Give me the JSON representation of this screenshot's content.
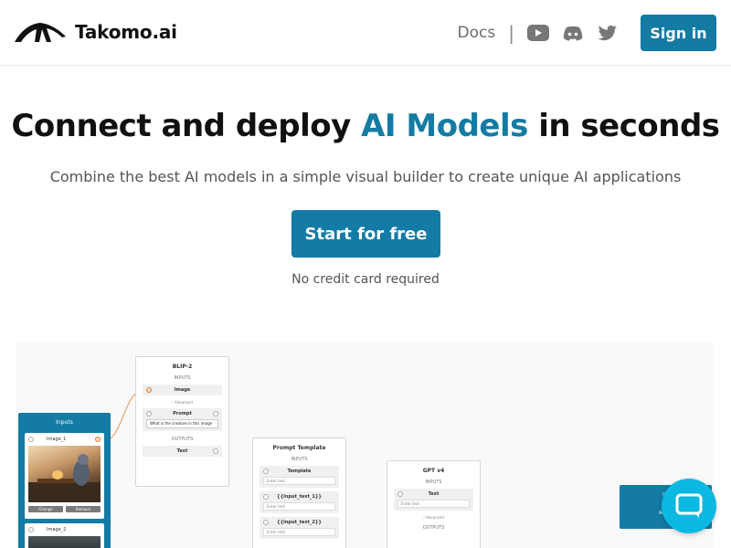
{
  "header": {
    "brand": "Takomo.ai",
    "nav_docs": "Docs",
    "nav_separator": "|",
    "icons": [
      "youtube-icon",
      "discord-icon",
      "twitter-icon"
    ],
    "signin_label": "Sign in"
  },
  "hero": {
    "title_prefix": "Connect and deploy ",
    "title_accent": "AI Models",
    "title_suffix": " in seconds",
    "subtitle": "Combine the best AI models in a simple visual builder to create unique AI applications",
    "cta_label": "Start for free",
    "cta_note": "No credit card required"
  },
  "builder": {
    "inputs_node": {
      "title": "Inputs",
      "image_1_label": "Image_1",
      "image_2_label": "Image_2",
      "change_label": "Change",
      "remove_label": "Remove"
    },
    "blip_node": {
      "title": "BLIP-2",
      "inputs_label": "INPUTS",
      "image_field": "Image",
      "advanced_label": "Advanced",
      "prompt_field": "Prompt",
      "prompt_value": "What is the creature in this image",
      "outputs_label": "OUTPUTS",
      "text_output": "Text"
    },
    "prompt_node": {
      "title": "Prompt Template",
      "inputs_label": "INPUTS",
      "template_field": "Template",
      "template_placeholder": "Enter text",
      "var1_field": "{{input_text_1}}",
      "var1_placeholder": "Enter text",
      "var2_field": "{{input_text_2}}",
      "var2_placeholder": "Enter text"
    },
    "gpt_node": {
      "title": "GPT v4",
      "inputs_label": "INPUTS",
      "text_field": "Text",
      "text_placeholder": "Enter text",
      "advanced_label": "Advanced",
      "outputs_label": "OUTPUTS"
    },
    "output_node": {
      "title": "Ou",
      "add_label": "Add O"
    }
  },
  "colors": {
    "brand": "#137ba4",
    "chat": "#0bb8e2"
  }
}
